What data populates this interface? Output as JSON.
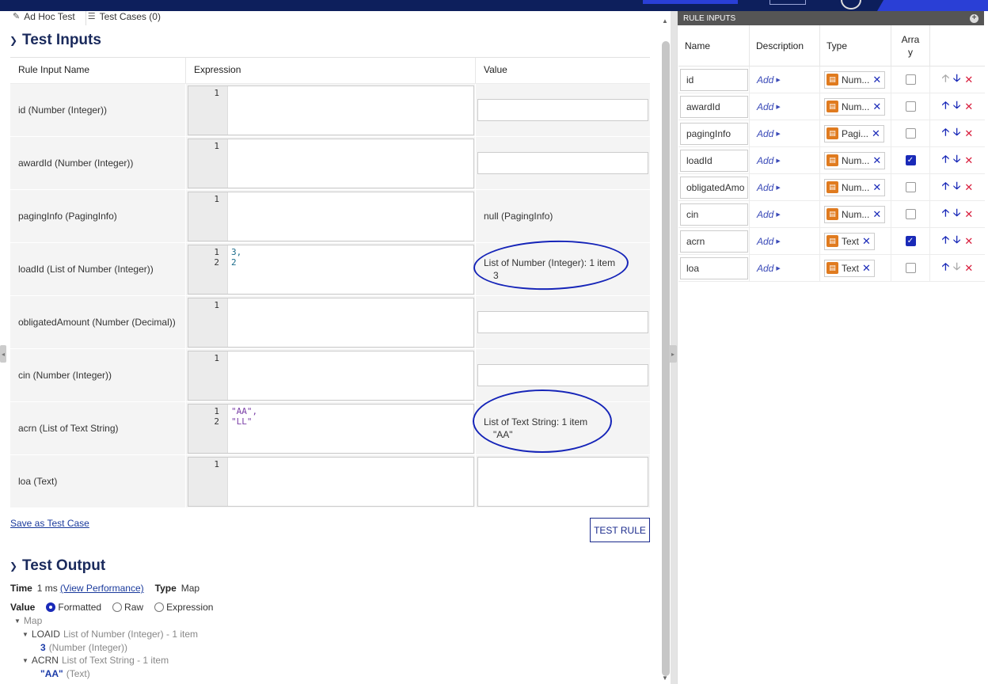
{
  "tabs": [
    {
      "label": "Ad Hoc Test",
      "icon": "edit-icon"
    },
    {
      "label": "Test Cases (0)",
      "icon": "list-icon"
    }
  ],
  "test_inputs": {
    "title": "Test Inputs",
    "columns": [
      "Rule Input Name",
      "Expression",
      "Value"
    ],
    "rows": [
      {
        "name": "id (Number (Integer))",
        "lines": [
          "1"
        ],
        "code": [],
        "value": ""
      },
      {
        "name": "awardId (Number (Integer))",
        "lines": [
          "1"
        ],
        "code": [],
        "value": ""
      },
      {
        "name": "pagingInfo (PagingInfo)",
        "lines": [
          "1"
        ],
        "code": [],
        "value": "null (PagingInfo)"
      },
      {
        "name": "loadId (List of Number (Integer))",
        "lines": [
          "1",
          "2"
        ],
        "code": [
          "3,",
          "2"
        ],
        "value": "List of Number (Integer): 1 item",
        "value2": "3"
      },
      {
        "name": "obligatedAmount (Number (Decimal))",
        "lines": [
          "1"
        ],
        "code": [],
        "value": ""
      },
      {
        "name": "cin (Number (Integer))",
        "lines": [
          "1"
        ],
        "code": [],
        "value": ""
      },
      {
        "name": "acrn (List of Text String)",
        "lines": [
          "1",
          "2"
        ],
        "code": [
          "\"AA\",",
          "\"LL\""
        ],
        "value": "List of Text String: 1 item",
        "value2": "\"AA\""
      },
      {
        "name": "loa (Text)",
        "lines": [
          "1"
        ],
        "code": [],
        "value": ""
      }
    ],
    "save_link": "Save as Test Case",
    "test_button": "TEST RULE"
  },
  "test_output": {
    "title": "Test Output",
    "time_label": "Time",
    "time_value": "1 ms",
    "perf_link": "(View Performance)",
    "type_label": "Type",
    "type_value": "Map",
    "value_label": "Value",
    "options": [
      "Formatted",
      "Raw",
      "Expression"
    ],
    "selected": "Formatted",
    "tree": {
      "root": "Map",
      "items": [
        {
          "key": "LOAID",
          "desc": "List of Number (Integer) - 1 item",
          "val": "3",
          "val_type": "(Number (Integer))"
        },
        {
          "key": "ACRN",
          "desc": "List of Text String - 1 item",
          "val": "\"AA\"",
          "val_type": "(Text)"
        }
      ]
    }
  },
  "rule_inputs": {
    "title": "RULE INPUTS",
    "columns": [
      "Name",
      "Description",
      "Type",
      "Arra\ny"
    ],
    "add_label": "Add",
    "rows": [
      {
        "name": "id",
        "type": "Num...",
        "array": false,
        "up_disabled": true,
        "down_disabled": false
      },
      {
        "name": "awardId",
        "type": "Num...",
        "array": false,
        "up_disabled": false,
        "down_disabled": false
      },
      {
        "name": "pagingInfo",
        "type": "Pagi...",
        "array": false,
        "up_disabled": false,
        "down_disabled": false
      },
      {
        "name": "loadId",
        "type": "Num...",
        "array": true,
        "up_disabled": false,
        "down_disabled": false
      },
      {
        "name": "obligatedAmo",
        "type": "Num...",
        "array": false,
        "up_disabled": false,
        "down_disabled": false
      },
      {
        "name": "cin",
        "type": "Num...",
        "array": false,
        "up_disabled": false,
        "down_disabled": false
      },
      {
        "name": "acrn",
        "type": "Text",
        "array": true,
        "up_disabled": false,
        "down_disabled": false
      },
      {
        "name": "loa",
        "type": "Text",
        "array": false,
        "up_disabled": false,
        "down_disabled": true
      }
    ]
  },
  "colors": {
    "primary": "#1a2ab8",
    "header": "#0d1f5c",
    "type_icon": "#e07b1f",
    "delete": "#d81b3a",
    "annotation": "#1524b8"
  }
}
